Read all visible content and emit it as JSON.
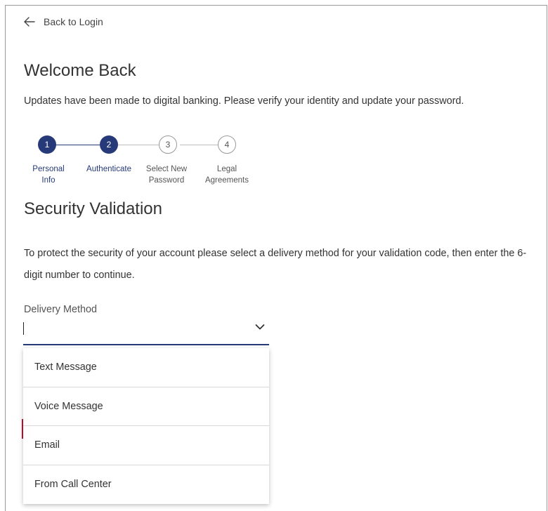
{
  "header": {
    "back_label": "Back to Login"
  },
  "page": {
    "title": "Welcome Back",
    "intro": "Updates have been made to digital banking. Please verify your identity and update your password."
  },
  "stepper": {
    "steps": [
      {
        "number": "1",
        "line1": "Personal",
        "line2": "Info",
        "state": "complete"
      },
      {
        "number": "2",
        "line1": "Authenticate",
        "line2": "",
        "state": "current"
      },
      {
        "number": "3",
        "line1": "Select New",
        "line2": "Password",
        "state": "pending"
      },
      {
        "number": "4",
        "line1": "Legal",
        "line2": "Agreements",
        "state": "pending"
      }
    ]
  },
  "security": {
    "title": "Security Validation",
    "description": "To protect the security of your account please select a delivery method for your validation code, then enter the 6-digit number to continue.",
    "delivery_label": "Delivery Method",
    "delivery_value": "",
    "options": [
      "Text Message",
      "Voice Message",
      "Email",
      "From Call Center"
    ]
  },
  "colors": {
    "primary": "#263a7a",
    "accent_red": "#c8102e",
    "border": "#9a9a9a"
  }
}
